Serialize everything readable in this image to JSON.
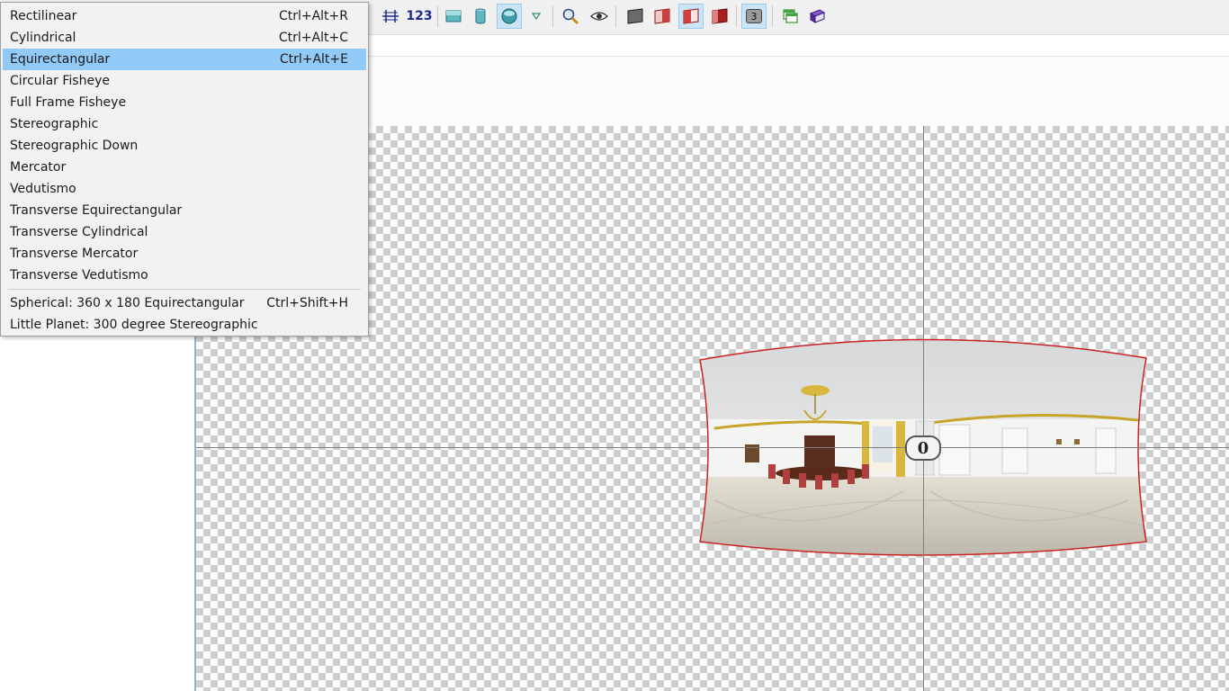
{
  "menu": {
    "items": [
      {
        "label": "Rectilinear",
        "shortcut": "Ctrl+Alt+R"
      },
      {
        "label": "Cylindrical",
        "shortcut": "Ctrl+Alt+C"
      },
      {
        "label": "Equirectangular",
        "shortcut": "Ctrl+Alt+E"
      },
      {
        "label": "Circular Fisheye",
        "shortcut": ""
      },
      {
        "label": "Full Frame Fisheye",
        "shortcut": ""
      },
      {
        "label": "Stereographic",
        "shortcut": ""
      },
      {
        "label": "Stereographic Down",
        "shortcut": ""
      },
      {
        "label": "Mercator",
        "shortcut": ""
      },
      {
        "label": "Vedutismo",
        "shortcut": ""
      },
      {
        "label": "Transverse Equirectangular",
        "shortcut": ""
      },
      {
        "label": "Transverse Cylindrical",
        "shortcut": ""
      },
      {
        "label": "Transverse Mercator",
        "shortcut": ""
      },
      {
        "label": "Transverse Vedutismo",
        "shortcut": ""
      }
    ],
    "presets": [
      {
        "label": "Spherical: 360 x 180 Equirectangular",
        "shortcut": "Ctrl+Shift+H"
      },
      {
        "label": "Little Planet: 300 degree Stereographic",
        "shortcut": ""
      }
    ]
  },
  "toolbar": {
    "numbers_label": "123",
    "layer_badge": "3"
  },
  "preview": {
    "center_label": "0"
  },
  "colors": {
    "highlight": "#91c9f7",
    "pano_outline": "#cc2222",
    "active_button": "#cce4f7"
  }
}
